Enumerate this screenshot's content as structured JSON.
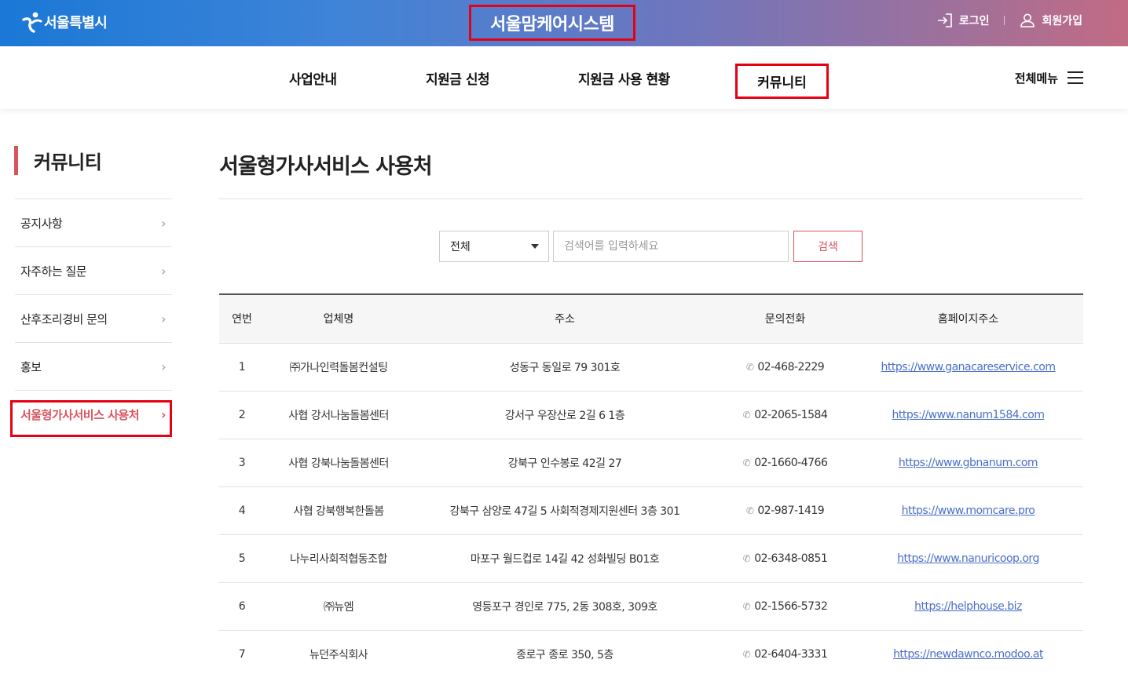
{
  "header": {
    "logo_text": "서울특별시",
    "system_title": "서울맘케어시스템",
    "login_label": "로그인",
    "signup_label": "회원가입"
  },
  "gnb": {
    "items": [
      "사업안내",
      "지원금 신청",
      "지원금 사용 현황",
      "커뮤니티"
    ],
    "active_index": 3,
    "all_menu_label": "전체메뉴"
  },
  "lnb": {
    "title": "커뮤니티",
    "items": [
      "공지사항",
      "자주하는 질문",
      "산후조리경비 문의",
      "홍보",
      "서울형가사서비스 사용처"
    ],
    "active_index": 4
  },
  "main": {
    "title": "서울형가사서비스 사용처",
    "search": {
      "select_value": "전체",
      "placeholder": "검색어를 입력하세요",
      "button_label": "검색"
    },
    "table": {
      "headers": [
        "연번",
        "업체명",
        "주소",
        "문의전화",
        "홈페이지주소"
      ],
      "rows": [
        {
          "no": "1",
          "name": "㈜가나인력돌봄컨설팅",
          "address": "성동구 동일로 79 301호",
          "phone": "02-468-2229",
          "homepage": "https://www.ganacareservice.com"
        },
        {
          "no": "2",
          "name": "사협 강서나눔돌봄센터",
          "address": "강서구 우장산로 2길 6 1층",
          "phone": "02-2065-1584",
          "homepage": "https://www.nanum1584.com"
        },
        {
          "no": "3",
          "name": "사협 강북나눔돌봄센터",
          "address": "강북구 인수봉로 42길 27",
          "phone": "02-1660-4766",
          "homepage": "https://www.gbnanum.com"
        },
        {
          "no": "4",
          "name": "사협 강북행복한돌봄",
          "address": "강북구 삼양로 47길 5 사회적경제지원센터 3층 301",
          "phone": "02-987-1419",
          "homepage": "https://www.momcare.pro"
        },
        {
          "no": "5",
          "name": "나누리사회적협동조합",
          "address": "마포구 월드컵로 14길 42 성화빌딩 B01호",
          "phone": "02-6348-0851",
          "homepage": "https://www.nanuricoop.org"
        },
        {
          "no": "6",
          "name": "㈜뉴엠",
          "address": "영등포구 경인로 775, 2동 308호, 309호",
          "phone": "02-1566-5732",
          "homepage": "https://helphouse.biz"
        },
        {
          "no": "7",
          "name": "뉴던주식회사",
          "address": "종로구 종로 350, 5층",
          "phone": "02-6404-3331",
          "homepage": "https://newdawnco.modoo.at"
        }
      ]
    }
  },
  "icons": {
    "phone": "phone-icon",
    "login": "login-icon",
    "user": "user-icon",
    "menu": "hamburger-icon",
    "chevron": "chevron-right-icon"
  },
  "colors": {
    "accent": "#d9535f",
    "highlight_box": "#e60012",
    "link": "#4a6fc9"
  }
}
